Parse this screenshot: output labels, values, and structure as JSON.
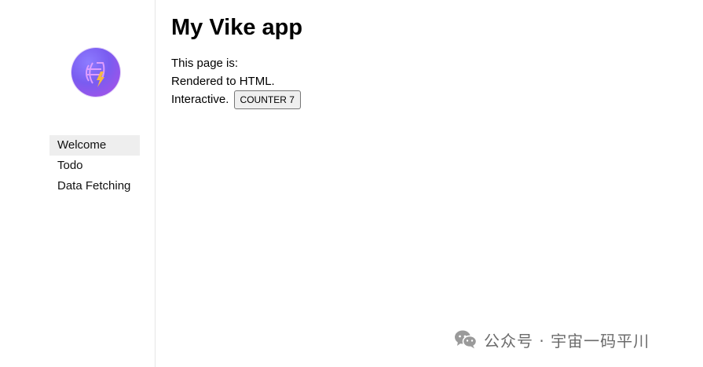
{
  "sidebar": {
    "logo_name": "vike-logo",
    "items": [
      {
        "label": "Welcome",
        "active": true
      },
      {
        "label": "Todo",
        "active": false
      },
      {
        "label": "Data Fetching",
        "active": false
      }
    ]
  },
  "main": {
    "title": "My Vike app",
    "line1": "This page is:",
    "line2": "Rendered to HTML.",
    "line3": "Interactive.",
    "counter_label": "COUNTER 7"
  },
  "watermark": {
    "icon": "wechat-icon",
    "text": "公众号 · 宇宙一码平川"
  },
  "colors": {
    "active_bg": "#eeeeee",
    "logo_start": "#8d7cff",
    "logo_end": "#b04fe6",
    "logo_accent": "#f5b942"
  }
}
